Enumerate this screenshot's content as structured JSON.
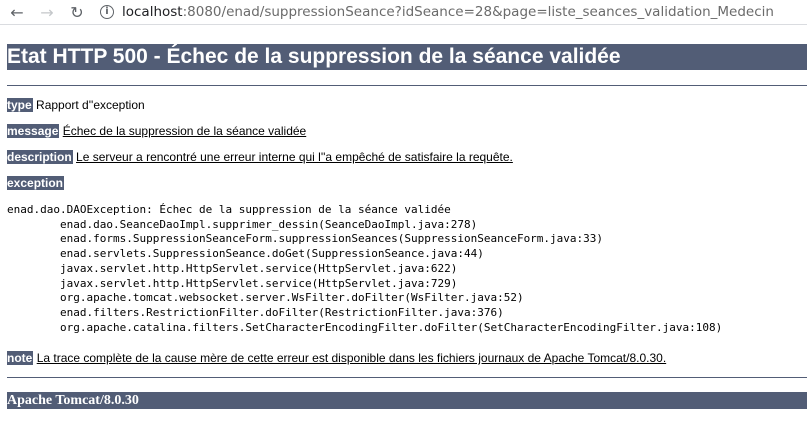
{
  "browser": {
    "url_host": "localhost",
    "url_rest": ":8080/enad/suppressionSeance?idSeance=28&page=liste_seances_validation_Medecin"
  },
  "error": {
    "title": "Etat HTTP 500 - Échec de la suppression de la séance validée",
    "type_label": "type",
    "type_value": "Rapport d''exception",
    "message_label": "message",
    "message_value": "Échec de la suppression de la séance validée",
    "description_label": "description",
    "description_value": "Le serveur a rencontré une erreur interne qui l''a empêché de satisfaire la requête.",
    "exception_label": "exception",
    "stack_trace": "enad.dao.DAOException: Échec de la suppression de la séance validée\n\tenad.dao.SeanceDaoImpl.supprimer_dessin(SeanceDaoImpl.java:278)\n\tenad.forms.SuppressionSeanceForm.suppressionSeances(SuppressionSeanceForm.java:33)\n\tenad.servlets.SuppressionSeance.doGet(SuppressionSeance.java:44)\n\tjavax.servlet.http.HttpServlet.service(HttpServlet.java:622)\n\tjavax.servlet.http.HttpServlet.service(HttpServlet.java:729)\n\torg.apache.tomcat.websocket.server.WsFilter.doFilter(WsFilter.java:52)\n\tenad.filters.RestrictionFilter.doFilter(RestrictionFilter.java:376)\n\torg.apache.catalina.filters.SetCharacterEncodingFilter.doFilter(SetCharacterEncodingFilter.java:108)",
    "note_label": "note",
    "note_value": "La trace complète de la cause mère de cette erreur est disponible dans les fichiers journaux de Apache Tomcat/8.0.30.",
    "footer": "Apache Tomcat/8.0.30"
  }
}
